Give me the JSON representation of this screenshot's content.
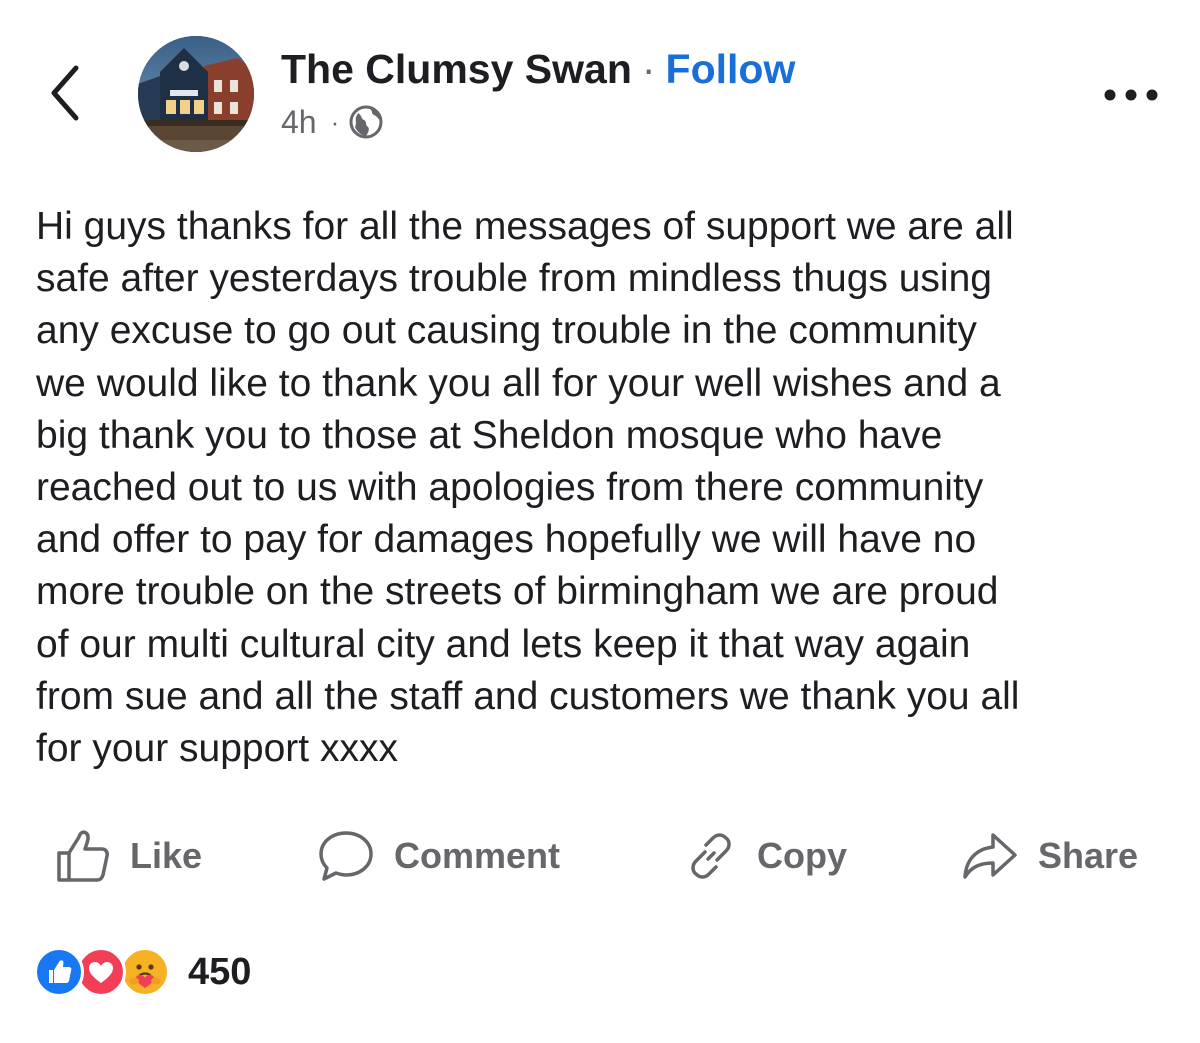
{
  "header": {
    "page_name": "The Clumsy Swan",
    "separator": "·",
    "follow_label": "Follow",
    "time_ago": "4h",
    "time_separator": "·",
    "audience_icon": "globe-icon"
  },
  "post": {
    "lines": [
      "Hi guys thanks for all the messages of support we are all",
      "safe after yesterdays trouble from mindless thugs using",
      "any excuse to go out causing trouble in the community",
      "we would like to thank you all for your well wishes and a",
      "big thank you to those at Sheldon mosque who have",
      "reached out to us with apologies from there community",
      "and offer to pay for damages hopefully we will have no",
      "more trouble on the streets of birmingham we are proud",
      "of our multi cultural city and lets keep it that way again",
      "from sue and all the staff and customers we thank you all",
      "for your support xxxx"
    ]
  },
  "actions": {
    "like": {
      "label": "Like",
      "icon": "thumbs-up-icon"
    },
    "comment": {
      "label": "Comment",
      "icon": "speech-bubble-icon"
    },
    "copy": {
      "label": "Copy",
      "icon": "link-icon"
    },
    "share": {
      "label": "Share",
      "icon": "share-arrow-icon"
    }
  },
  "reactions": {
    "types": [
      "like-reaction-icon",
      "love-reaction-icon",
      "care-reaction-icon"
    ],
    "count": "450"
  },
  "colors": {
    "brand_blue": "#1a6ed8",
    "text_primary": "#1c1e21",
    "text_secondary": "#65676b",
    "like_blue": "#1877f2",
    "love_red": "#f33e58",
    "care_yellow": "#f7b125"
  }
}
